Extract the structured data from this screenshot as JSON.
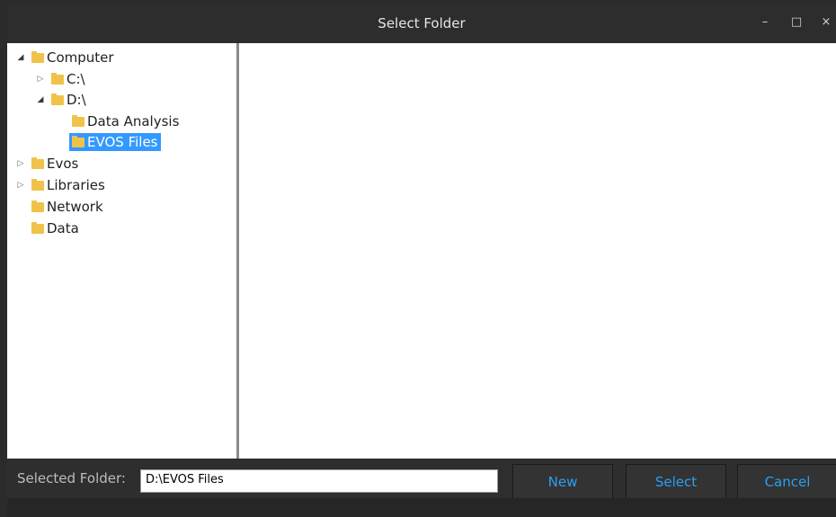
{
  "window": {
    "title": "Select Folder",
    "minimize_glyph": "–",
    "maximize_glyph": "□",
    "close_glyph": "×"
  },
  "tree": {
    "items": [
      {
        "label": "Computer",
        "expander": "open"
      },
      {
        "label": "C:\\",
        "expander": "collapsed"
      },
      {
        "label": "D:\\",
        "expander": "open"
      },
      {
        "label": "Data Analysis",
        "expander": "none"
      },
      {
        "label": "EVOS Files",
        "expander": "none",
        "selected": true
      },
      {
        "label": "Evos",
        "expander": "collapsed"
      },
      {
        "label": "Libraries",
        "expander": "collapsed"
      },
      {
        "label": "Network",
        "expander": "none"
      },
      {
        "label": "Data",
        "expander": "none"
      }
    ]
  },
  "footer": {
    "selected_label": "Selected Folder:",
    "selected_value": "D:\\EVOS Files",
    "new_label": "New",
    "select_label": "Select",
    "cancel_label": "Cancel"
  },
  "colors": {
    "accent": "#2a9ff5",
    "selection": "#3399ff",
    "folder": "#f1c24a",
    "chrome": "#2d2d2d"
  },
  "icons": {
    "expander_open": "triangle-down-right",
    "expander_collapsed": "triangle-right",
    "folder": "folder-icon"
  }
}
